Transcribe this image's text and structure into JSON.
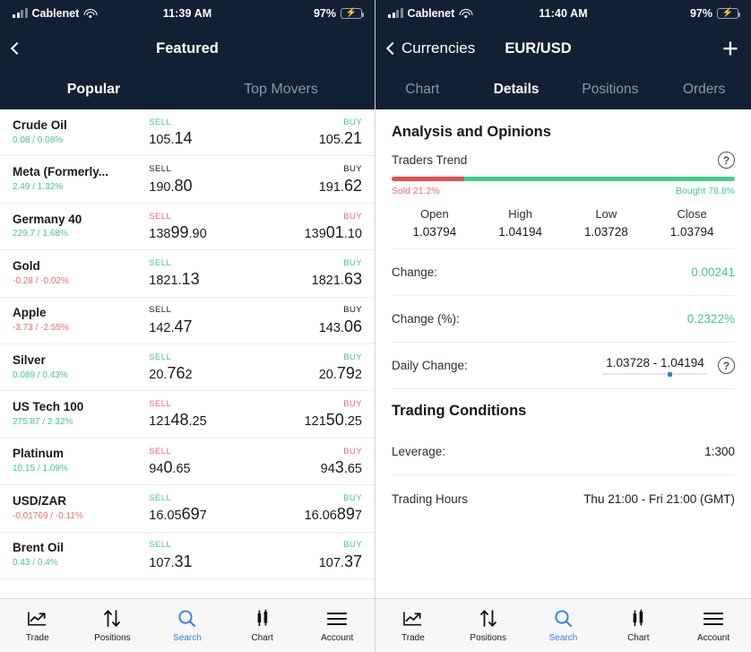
{
  "colors": {
    "header_bg": "#131f33",
    "up": "#47c49a",
    "down": "#ef6b6b",
    "accent": "#2f7fe8",
    "sold": "#ef4d4d",
    "bought": "#3ecf8e"
  },
  "left": {
    "status": {
      "carrier": "Cablenet",
      "time": "11:39 AM",
      "battery": "97%",
      "battery_level": 97,
      "charging": true,
      "wifi_icon": "wifi-icon",
      "signal_icon": "cellular-signal-icon",
      "battery_icon": "battery-charging-icon"
    },
    "nav": {
      "back_icon": "chevron-left-icon",
      "back_label": "",
      "title": "Featured"
    },
    "tabs": [
      {
        "label": "Popular",
        "active": true
      },
      {
        "label": "Top Movers",
        "active": false
      }
    ],
    "instruments": [
      {
        "symbol": "Crude Oil",
        "change": "0.08 / 0.08%",
        "change_dir": "up",
        "sell_label": "SELL",
        "buy_label": "BUY",
        "side_dir": "up",
        "sell": {
          "pre": "105.",
          "big": "14",
          "post": ""
        },
        "buy": {
          "pre": "105.",
          "big": "21",
          "post": ""
        }
      },
      {
        "symbol": "Meta (Formerly...",
        "change": "2.49 / 1.32%",
        "change_dir": "up",
        "sell_label": "SELL",
        "buy_label": "BUY",
        "side_dir": "neutral",
        "sell": {
          "pre": "190.",
          "big": "80",
          "post": ""
        },
        "buy": {
          "pre": "191.",
          "big": "62",
          "post": ""
        }
      },
      {
        "symbol": "Germany 40",
        "change": "229.7 / 1.68%",
        "change_dir": "up",
        "sell_label": "SELL",
        "buy_label": "BUY",
        "side_dir": "down",
        "sell": {
          "pre": "138",
          "big": "99",
          "post": ".90"
        },
        "buy": {
          "pre": "139",
          "big": "01",
          "post": ".10"
        }
      },
      {
        "symbol": "Gold",
        "change": "-0.28 / -0.02%",
        "change_dir": "down",
        "sell_label": "SELL",
        "buy_label": "BUY",
        "side_dir": "up",
        "sell": {
          "pre": "1821.",
          "big": "13",
          "post": ""
        },
        "buy": {
          "pre": "1821.",
          "big": "63",
          "post": ""
        }
      },
      {
        "symbol": "Apple",
        "change": "-3.73 / -2.55%",
        "change_dir": "down",
        "sell_label": "SELL",
        "buy_label": "BUY",
        "side_dir": "neutral",
        "sell": {
          "pre": "142.",
          "big": "47",
          "post": ""
        },
        "buy": {
          "pre": "143.",
          "big": "06",
          "post": ""
        }
      },
      {
        "symbol": "Silver",
        "change": "0.089 / 0.43%",
        "change_dir": "up",
        "sell_label": "SELL",
        "buy_label": "BUY",
        "side_dir": "up",
        "sell": {
          "pre": "20.",
          "big": "76",
          "post": "2"
        },
        "buy": {
          "pre": "20.",
          "big": "79",
          "post": "2"
        }
      },
      {
        "symbol": "US Tech 100",
        "change": "275.87 / 2.32%",
        "change_dir": "up",
        "sell_label": "SELL",
        "buy_label": "BUY",
        "side_dir": "down",
        "sell": {
          "pre": "121",
          "big": "48",
          "post": ".25"
        },
        "buy": {
          "pre": "121",
          "big": "50",
          "post": ".25"
        }
      },
      {
        "symbol": "Platinum",
        "change": "10.15 / 1.09%",
        "change_dir": "up",
        "sell_label": "SELL",
        "buy_label": "BUY",
        "side_dir": "down",
        "sell": {
          "pre": "94",
          "big": "0",
          "post": ".65"
        },
        "buy": {
          "pre": "94",
          "big": "3",
          "post": ".65"
        }
      },
      {
        "symbol": "USD/ZAR",
        "change": "-0.01769 / -0.11%",
        "change_dir": "down",
        "sell_label": "SELL",
        "buy_label": "BUY",
        "side_dir": "up",
        "sell": {
          "pre": "16.05",
          "big": "69",
          "post": "7"
        },
        "buy": {
          "pre": "16.06",
          "big": "89",
          "post": "7"
        }
      },
      {
        "symbol": "Brent Oil",
        "change": "0.43 / 0.4%",
        "change_dir": "up",
        "sell_label": "SELL",
        "buy_label": "BUY",
        "side_dir": "up",
        "sell": {
          "pre": "107.",
          "big": "31",
          "post": ""
        },
        "buy": {
          "pre": "107.",
          "big": "37",
          "post": ""
        }
      }
    ],
    "tabbar": [
      {
        "label": "Trade",
        "icon": "line-chart-icon",
        "active": false
      },
      {
        "label": "Positions",
        "icon": "arrows-up-down-icon",
        "active": false
      },
      {
        "label": "Search",
        "icon": "search-icon",
        "active": true
      },
      {
        "label": "Chart",
        "icon": "candlestick-icon",
        "active": false
      },
      {
        "label": "Account",
        "icon": "hamburger-menu-icon",
        "active": false
      }
    ]
  },
  "right": {
    "status": {
      "carrier": "Cablenet",
      "time": "11:40 AM",
      "battery": "97%",
      "battery_level": 97,
      "charging": true,
      "wifi_icon": "wifi-icon",
      "signal_icon": "cellular-signal-icon",
      "battery_icon": "battery-charging-icon"
    },
    "nav": {
      "back_icon": "chevron-left-icon",
      "back_label": "Currencies",
      "title": "EUR/USD",
      "add_icon": "plus-icon"
    },
    "tabs": [
      {
        "label": "Chart",
        "active": false
      },
      {
        "label": "Details",
        "active": true
      },
      {
        "label": "Positions",
        "active": false
      },
      {
        "label": "Orders",
        "active": false
      }
    ],
    "analysis": {
      "section_title": "Analysis and Opinions",
      "trend_label": "Traders Trend",
      "help_icon": "question-mark-icon",
      "sold_label": "Sold 21.2%",
      "bought_label": "Bought 78.8%",
      "sold_pct": 21.2,
      "bought_pct": 78.8,
      "ohlc": [
        {
          "header": "Open",
          "value": "1.03794"
        },
        {
          "header": "High",
          "value": "1.04194"
        },
        {
          "header": "Low",
          "value": "1.03728"
        },
        {
          "header": "Close",
          "value": "1.03794"
        }
      ],
      "rows": [
        {
          "key": "Change:",
          "value": "0.00241",
          "dir": "up"
        },
        {
          "key": "Change (%):",
          "value": "0.2322%",
          "dir": "up"
        }
      ],
      "daily": {
        "key": "Daily Change:",
        "value": "1.03728 - 1.04194",
        "marker_pct": 62,
        "help_icon": "question-mark-icon"
      }
    },
    "conditions": {
      "section_title": "Trading Conditions",
      "rows": [
        {
          "key": "Leverage:",
          "value": "1:300"
        },
        {
          "key": "Trading Hours",
          "value": "Thu 21:00 - Fri 21:00 (GMT)"
        }
      ]
    },
    "tabbar": [
      {
        "label": "Trade",
        "icon": "line-chart-icon",
        "active": false
      },
      {
        "label": "Positions",
        "icon": "arrows-up-down-icon",
        "active": false
      },
      {
        "label": "Search",
        "icon": "search-icon",
        "active": true
      },
      {
        "label": "Chart",
        "icon": "candlestick-icon",
        "active": false
      },
      {
        "label": "Account",
        "icon": "hamburger-menu-icon",
        "active": false
      }
    ]
  }
}
